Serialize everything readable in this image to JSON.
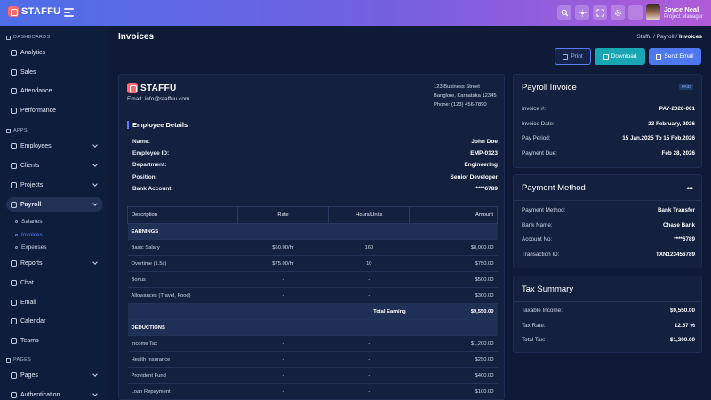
{
  "brand": {
    "name": "STAFFU",
    "accent": "#ff6b6b"
  },
  "topbar": {
    "icons": [
      "search-icon",
      "sun-icon",
      "fullscreen-icon",
      "settings-icon",
      "grid-icon"
    ],
    "user": {
      "name": "Joyce Neal",
      "role": "Project Manager"
    }
  },
  "sidebar": {
    "sections": [
      {
        "title": "DASHBOARDS"
      },
      {
        "title": "APPS"
      },
      {
        "title": "PAGES"
      }
    ],
    "dashboards": [
      "Analytics",
      "Sales",
      "Attendance",
      "Performance"
    ],
    "apps": [
      "Employees",
      "Clients",
      "Projects",
      "Payroll"
    ],
    "payroll_sub": [
      "Salaries",
      "Invoices",
      "Expenses"
    ],
    "apps2": [
      "Reports",
      "Chat",
      "Email",
      "Calendar",
      "Teams"
    ],
    "pages": [
      "Pages",
      "Authentication"
    ]
  },
  "header": {
    "title": "Invoices",
    "breadcrumb": [
      "Staffu",
      "Payroll",
      "Invoices"
    ],
    "buttons": {
      "print": "Print",
      "download": "Download",
      "send": "Send Email"
    }
  },
  "invoice": {
    "logo_text": "STAFFU",
    "email": "Email: info@staffuu.com",
    "address": [
      "123 Business Street",
      "Banglore, Karnataka 12345",
      "Phone: (123) 456-7890"
    ],
    "employee_title": "Employee Details",
    "employee": [
      {
        "label": "Name:",
        "value": "John Doe"
      },
      {
        "label": "Employee ID:",
        "value": "EMP-0123"
      },
      {
        "label": "Department:",
        "value": "Engineering"
      },
      {
        "label": "Position:",
        "value": "Senior Developer"
      },
      {
        "label": "Bank Account:",
        "value": "****6789"
      }
    ],
    "table": {
      "headers": [
        "Description",
        "Rate",
        "Hours/Units",
        "Amount"
      ],
      "earnings_label": "EARNINGS",
      "earnings": [
        [
          "Basic Salary",
          "$50.00/hr",
          "160",
          "$8,000.00"
        ],
        [
          "Overtime (1.5x)",
          "$75.00/hr",
          "10",
          "$750.00"
        ],
        [
          "Bonus",
          "-",
          "-",
          "$500.00"
        ],
        [
          "Allowances (Travel, Food)",
          "-",
          "-",
          "$300.00"
        ]
      ],
      "total_earning_label": "Total Earning",
      "total_earning": "$9,550.00",
      "deductions_label": "DEDUCTIONS",
      "deductions": [
        [
          "Income Tax",
          "-",
          "-",
          "$1,200.00"
        ],
        [
          "Health Insurance",
          "-",
          "-",
          "$250.00"
        ],
        [
          "Provident Fund",
          "-",
          "-",
          "$400.00"
        ],
        [
          "Loan Repayment",
          "-",
          "-",
          "$100.00"
        ]
      ]
    }
  },
  "payroll_invoice": {
    "title": "Payroll Invoice",
    "badge": "PAID",
    "rows": [
      {
        "label": "Invoice #:",
        "value": "PAY-2026-001"
      },
      {
        "label": "Invoice Date:",
        "value": "23 February, 2026"
      },
      {
        "label": "Pay Period:",
        "value": "15 Jan,2025 To 15 Feb,2026"
      },
      {
        "label": "Payment Due:",
        "value": "Feb 28, 2026"
      }
    ]
  },
  "payment_method": {
    "title": "Payment Method",
    "menu": "•••",
    "rows": [
      {
        "label": "Payment Method:",
        "value": "Bank Transfer"
      },
      {
        "label": "Bank Name:",
        "value": "Chase Bank"
      },
      {
        "label": "Account No:",
        "value": "****6789"
      },
      {
        "label": "Transaction ID:",
        "value": "TXN123456789"
      }
    ]
  },
  "tax_summary": {
    "title": "Tax Summary",
    "rows": [
      {
        "label": "Taxable Income:",
        "value": "$9,550.00"
      },
      {
        "label": "Tax Rate:",
        "value": "12.57 %"
      },
      {
        "label": "Total Tax:",
        "value": "$1,200.00"
      }
    ]
  }
}
